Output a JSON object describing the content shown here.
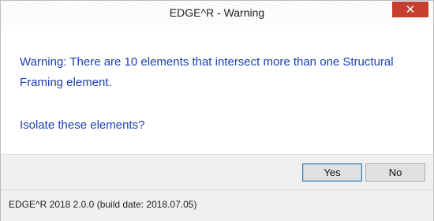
{
  "window": {
    "title": "EDGE^R - Warning",
    "close_glyph": "✕"
  },
  "message": {
    "text": "Warning: There are 10 elements that intersect more than one Structural Framing element.",
    "question": "Isolate these elements?"
  },
  "buttons": {
    "yes_label": "Yes",
    "no_label": "No"
  },
  "status": {
    "text": "EDGE^R 2018 2.0.0 (build date: 2018.07.05)"
  },
  "colors": {
    "message_text": "#1a3fb0",
    "close_button": "#c7402f"
  }
}
